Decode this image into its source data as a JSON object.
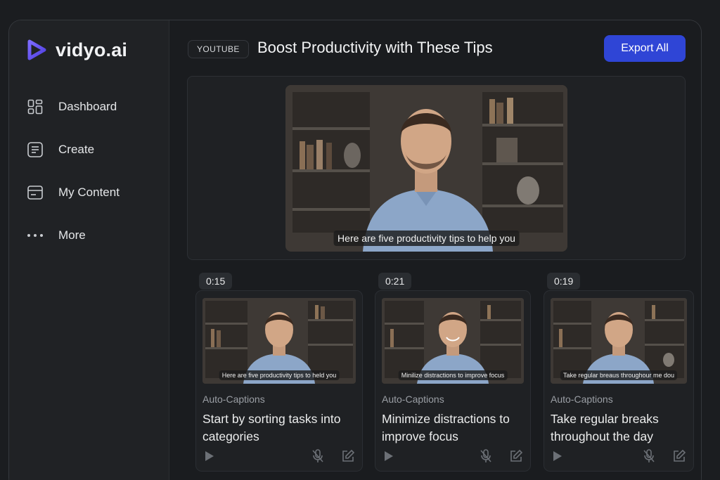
{
  "brand": {
    "name": "vidyo.ai",
    "accent": "#6b5cf6"
  },
  "sidebar": {
    "items": [
      {
        "label": "Dashboard",
        "icon": "dashboard-icon"
      },
      {
        "label": "Create",
        "icon": "document-icon"
      },
      {
        "label": "My Content",
        "icon": "content-icon"
      },
      {
        "label": "More",
        "icon": "more-icon"
      }
    ]
  },
  "header": {
    "source": "YOUTUBE",
    "title": "Boost Productivity with These Tips",
    "export_label": "Export All",
    "export_color": "#2f45d6"
  },
  "hero": {
    "caption": "Here are five productivity tips to help you"
  },
  "clips": [
    {
      "duration": "0:15",
      "caption": "Here are five productivity tips to held you",
      "tag": "Auto-Captions",
      "title": "Start by sorting tasks into categories"
    },
    {
      "duration": "0:21",
      "caption": "Minilize distractions to improve focus",
      "tag": "Auto-Captions",
      "title": "Minimize distractions to improve focus"
    },
    {
      "duration": "0:19",
      "caption": "Take regular breaus throughour me dou",
      "tag": "Auto-Captions",
      "title": "Take regular breaks throughout the day"
    }
  ]
}
